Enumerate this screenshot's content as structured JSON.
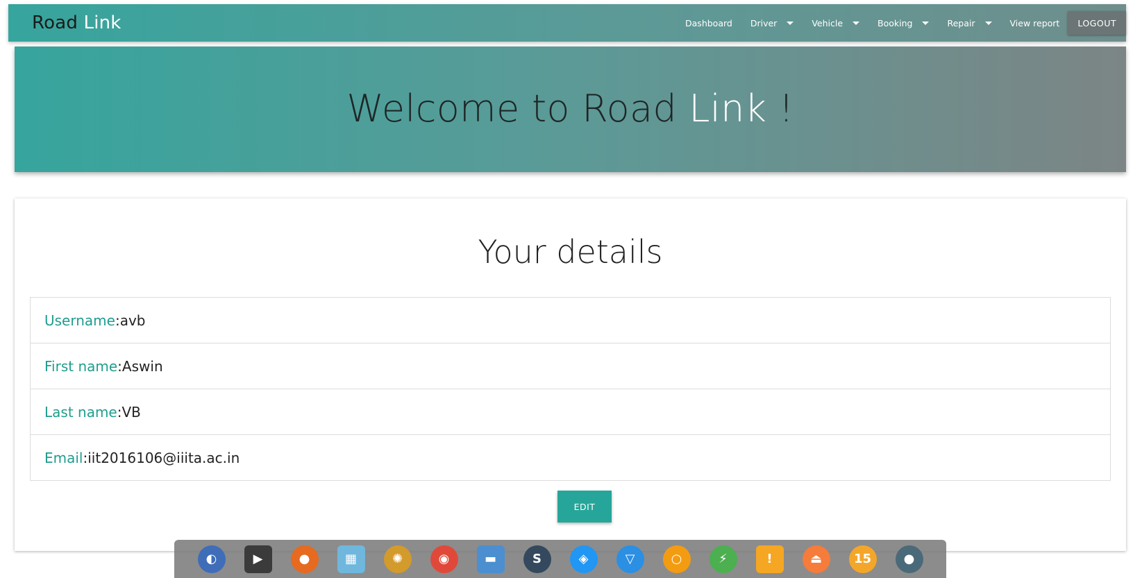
{
  "navbar": {
    "brand_part1": "Road",
    "brand_part2": " Link",
    "items": [
      {
        "label": "Dashboard",
        "dropdown": false
      },
      {
        "label": "Driver",
        "dropdown": true
      },
      {
        "label": "Vehicle",
        "dropdown": true
      },
      {
        "label": "Booking",
        "dropdown": true
      },
      {
        "label": "Repair",
        "dropdown": true
      },
      {
        "label": "View report",
        "dropdown": false
      }
    ],
    "logout_label": "LOGOUT"
  },
  "banner": {
    "title_part1": "Welcome to Road ",
    "title_part2": "Link",
    "title_part3": " !"
  },
  "details_card": {
    "title": "Your details",
    "rows": [
      {
        "label": "Username",
        "value": "avb"
      },
      {
        "label": "First name",
        "value": "Aswin"
      },
      {
        "label": "Last name",
        "value": "VB"
      },
      {
        "label": "Email",
        "value": "iit2016106@iiita.ac.in"
      }
    ],
    "separator": " : ",
    "edit_label": "EDIT"
  },
  "dock": {
    "icons": [
      {
        "name": "launcher-icon",
        "color": "#3f6db8",
        "glyph": "◐"
      },
      {
        "name": "terminal-icon",
        "color": "#3b3b3b",
        "glyph": "▶"
      },
      {
        "name": "firefox-icon",
        "color": "#e66a1f",
        "glyph": "●"
      },
      {
        "name": "maps-icon",
        "color": "#6fb7dd",
        "glyph": "▦"
      },
      {
        "name": "helm-icon",
        "color": "#d39a2c",
        "glyph": "✺"
      },
      {
        "name": "chrome-icon",
        "color": "#e0493a",
        "glyph": "◉"
      },
      {
        "name": "files-icon",
        "color": "#4b8fd1",
        "glyph": "▬"
      },
      {
        "name": "sublime-icon",
        "color": "#34495e",
        "glyph": "S"
      },
      {
        "name": "security-icon",
        "color": "#2196f3",
        "glyph": "◈"
      },
      {
        "name": "network-icon",
        "color": "#2b8fe3",
        "glyph": "▽"
      },
      {
        "name": "record-icon",
        "color": "#f39c12",
        "glyph": "○"
      },
      {
        "name": "power-icon",
        "color": "#4caf50",
        "glyph": "⚡"
      },
      {
        "name": "warning-icon",
        "color": "#f5a623",
        "glyph": "!"
      },
      {
        "name": "eject-icon",
        "color": "#f57c3a",
        "glyph": "⏏"
      },
      {
        "name": "clock-icon",
        "color": "#f4a62a",
        "glyph": "15"
      },
      {
        "name": "drop-icon",
        "color": "#4a6a7a",
        "glyph": "●"
      }
    ]
  }
}
